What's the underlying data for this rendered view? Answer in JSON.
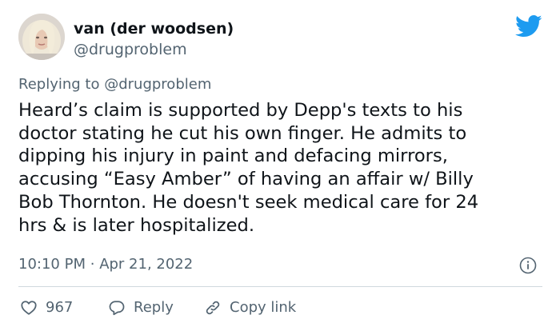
{
  "author": {
    "display_name": "van (der woodsen)",
    "handle": "@drugproblem"
  },
  "reply_context": {
    "prefix": "Replying to",
    "mention": "@drugproblem"
  },
  "tweet_lines": [
    "Heard’s claim is supported by Depp's texts to his",
    "doctor stating he cut his own finger. He admits to",
    "dipping his injury in paint and defacing mirrors,",
    "accusing “Easy Amber” of having an affair w/ Billy",
    "Bob Thornton. He doesn't seek medical care for 24",
    "hrs & is later hospitalized."
  ],
  "meta": {
    "time": "10:10 PM",
    "separator": "·",
    "date": "Apr 21, 2022"
  },
  "actions": {
    "like_count": "967",
    "reply_label": "Reply",
    "copy_link_label": "Copy link"
  },
  "icons": {
    "logo": "twitter-bird-icon",
    "info": "info-icon",
    "like": "heart-icon",
    "reply": "speech-bubble-icon",
    "copy": "link-icon"
  },
  "colors": {
    "twitter_blue": "#1d9bf0",
    "text_primary": "#0f1419",
    "text_secondary": "#536471",
    "divider": "#cfd9de"
  }
}
